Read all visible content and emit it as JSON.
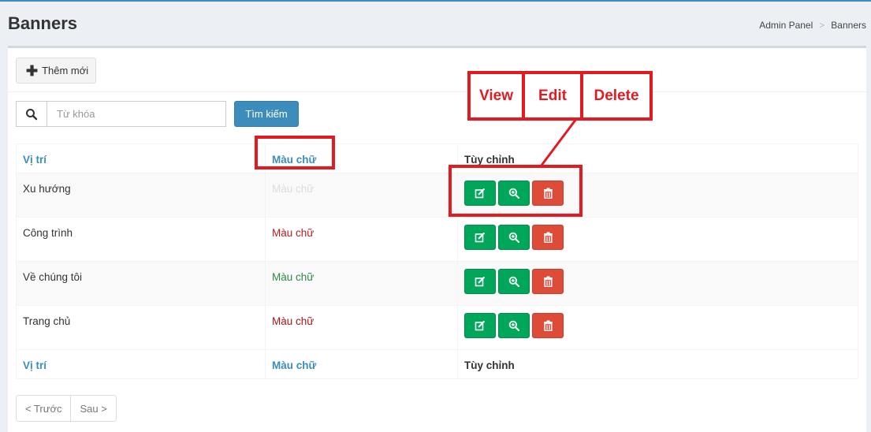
{
  "page": {
    "title": "Banners"
  },
  "breadcrumb": {
    "items": [
      "Admin Panel",
      "Banners"
    ],
    "separator": ">"
  },
  "toolbar": {
    "add_label": "Thêm mới"
  },
  "search": {
    "placeholder": "Từ khóa",
    "value": "",
    "button_label": "Tìm kiếm"
  },
  "table": {
    "headers": [
      "Vị trí",
      "Màu chữ",
      "Tùy chỉnh"
    ],
    "rows": [
      {
        "position": "Xu hướng",
        "color_label": "Màu chữ",
        "color": "#dcdcdc"
      },
      {
        "position": "Công trình",
        "color_label": "Màu chữ",
        "color": "#b41f1f"
      },
      {
        "position": "Về chúng tôi",
        "color_label": "Màu chữ",
        "color": "#2c8a45"
      },
      {
        "position": "Trang chủ",
        "color_label": "Màu chữ",
        "color": "#a31818"
      }
    ]
  },
  "pagination": {
    "prev_label": "< Trước",
    "next_label": "Sau >"
  },
  "annotations": {
    "view": "View",
    "edit": "Edit",
    "delete": "Delete"
  },
  "colors": {
    "accent": "#3c8dbc",
    "success": "#00a65a",
    "danger": "#dd4b39",
    "annotation": "#e21b23"
  },
  "icons": {
    "add": "plus-icon",
    "search": "search-icon",
    "edit": "edit-icon",
    "view": "zoom-icon",
    "delete": "trash-icon"
  }
}
